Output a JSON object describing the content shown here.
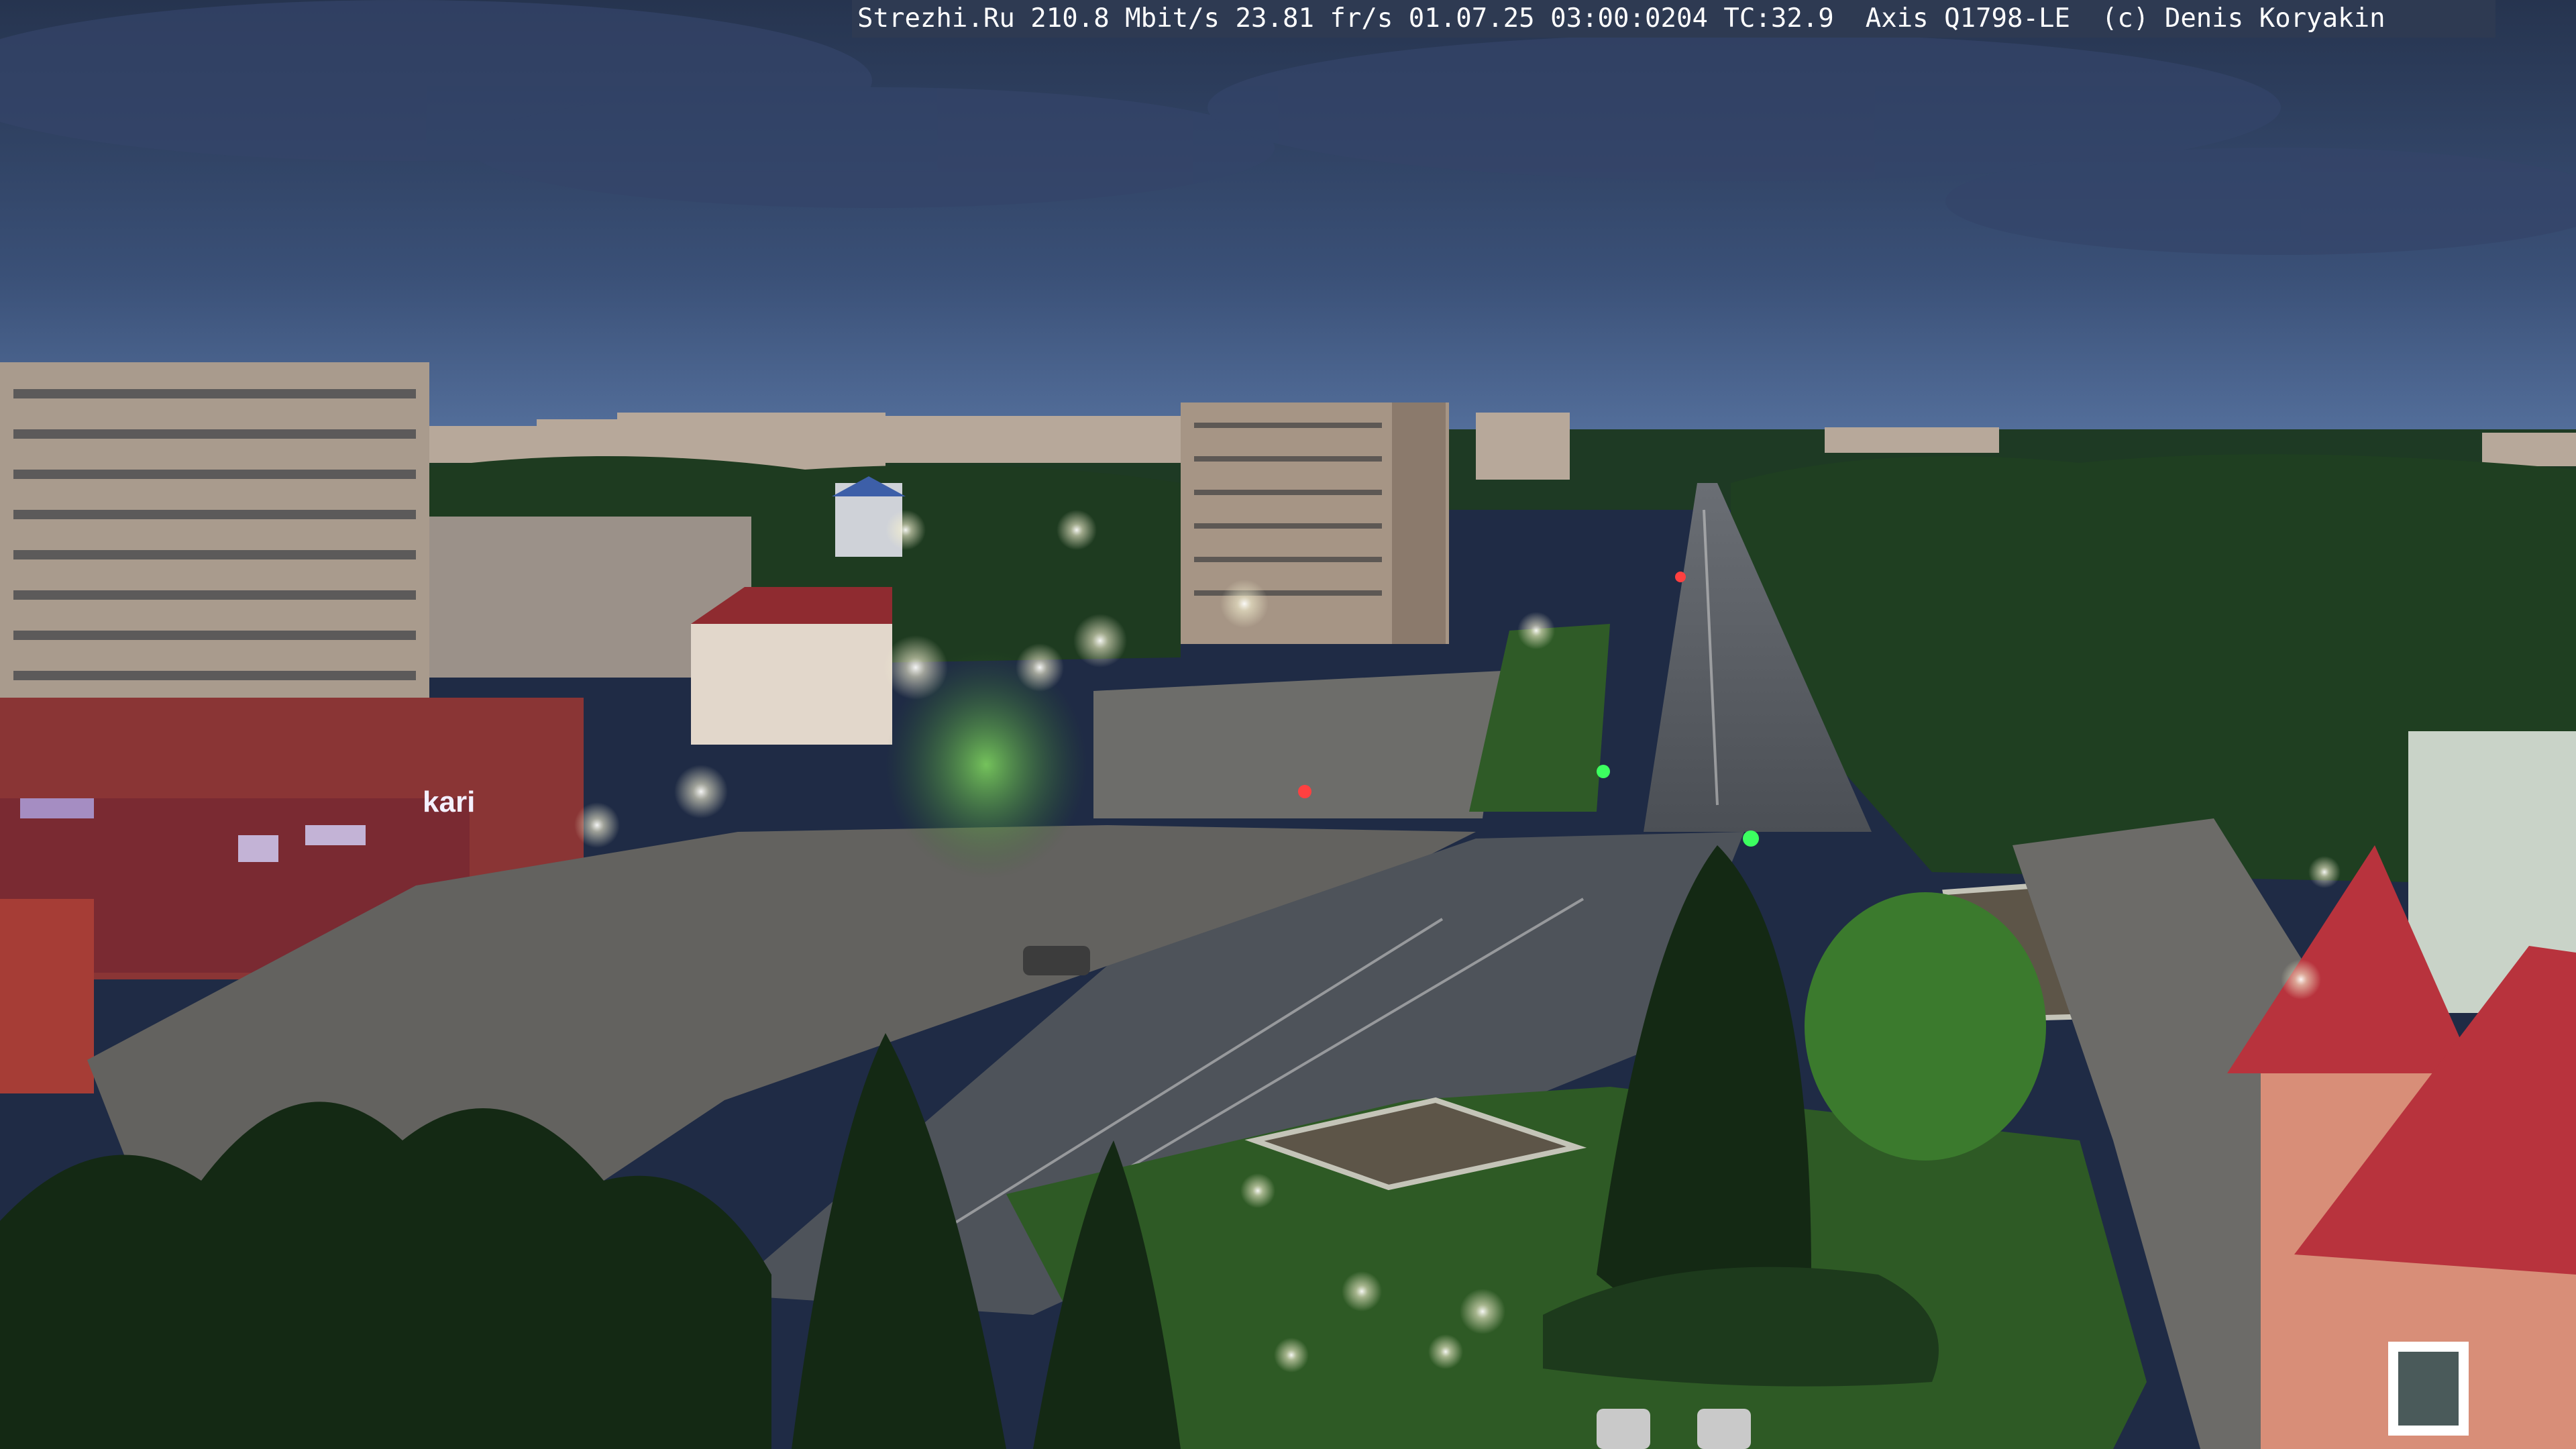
{
  "overlay": {
    "text": "Strezhi.Ru 210.8 Mbit/s 23.81 fr/s 01.07.25 03:00:0204 TC:32.9  Axis Q1798-LE  (c) Denis Koryakin"
  },
  "signs": {
    "kari": "kari"
  },
  "colors": {
    "sky_top": "#2b3a5c",
    "sky_horizon": "#4a6288",
    "trees": "#1c3a1a",
    "road": "#555a60",
    "plaza": "#6b6a66",
    "lamp_glow": "#f3f0d8",
    "roof_red": "#b8333d"
  }
}
